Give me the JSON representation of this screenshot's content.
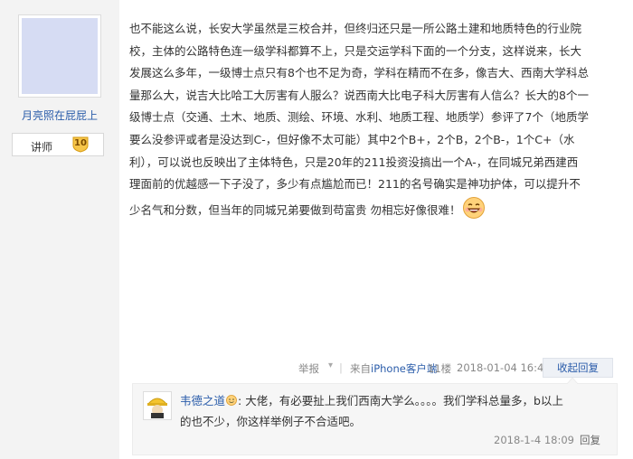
{
  "author": {
    "name": "月亮照在屁屁上",
    "rank_title": "讲师",
    "level": "10"
  },
  "post": {
    "lines": [
      "也不能这么说，长安大学虽然是三校合并，但终归还只是一所公路土建和地质特色的行业院",
      "校，主体的公路特色连一级学科都算不上，只是交运学科下面的一个分支，这样说来，长大",
      "发展这么多年，一级博士点只有8个也不足为奇，学科在精而不在多，像吉大、西南大学科总",
      "量那么大，说吉大比哈工大厉害有人服么？说西南大比电子科大厉害有人信么？长大的8个一",
      "级博士点（交通、土木、地质、测绘、环境、水利、地质工程、地质学）参评了7个（地质学",
      "要么没参评或者是没达到C-，但好像不太可能）其中2个B+，2个B，2个B-，1个C+（水",
      "利），可以说也反映出了主体特色，只是20年的211投资没搞出一个A-，在同城兄弟西建西",
      "理面前的优越感一下子没了，多少有点尴尬而已！211的名号确实是神功护体，可以提升不",
      "少名气和分数，但当年的同城兄弟要做到苟富贵 勿相忘好像很难！"
    ]
  },
  "footer": {
    "report": "举报",
    "report_arrow": "▾",
    "separator": "|",
    "source_prefix": "来自",
    "source_device": "iPhone客户端",
    "floor": "11楼",
    "datetime": "2018-01-04 16:46",
    "toggle_reply": "收起回复"
  },
  "reply": {
    "user": "韦德之道",
    "text_line1": ": 大佬，有必要扯上我们西南大学么。。。。我们学科总量多，b以上",
    "text_line2": "的也不少，你这样举例子不合适吧。",
    "datetime": "2018-1-4 18:09",
    "reply_label": "回复"
  },
  "colors": {
    "link": "#2a5caa",
    "sidebar_bg": "#f3f3f3",
    "avatar_placeholder": "#d6dcf3",
    "reply_bg": "#f6f6f6"
  }
}
